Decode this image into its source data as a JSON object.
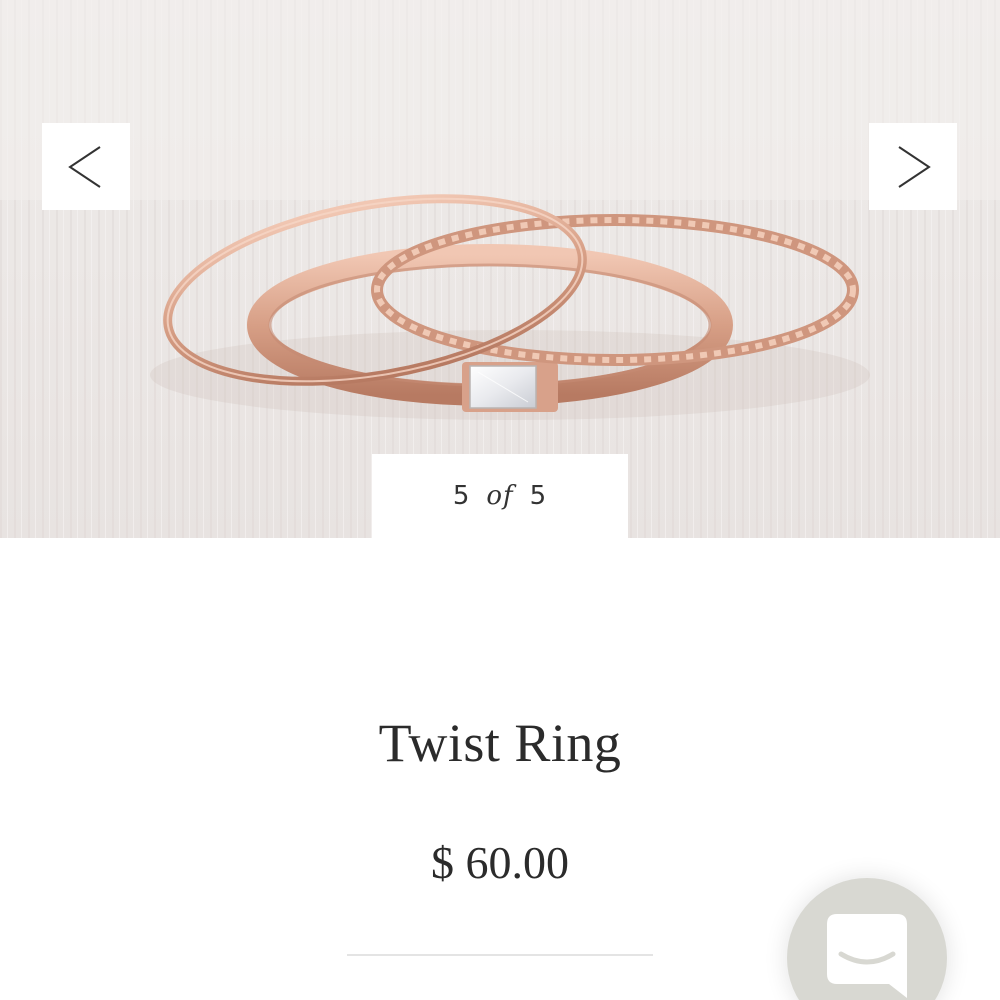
{
  "gallery": {
    "image_alt": "Stack of rose gold rings: plain band, twisted band and baguette diamond band",
    "prev_label": "<",
    "next_label": ">",
    "current": "5",
    "of_word": "of",
    "total": "5"
  },
  "product": {
    "title": "Twist Ring",
    "price": "$ 60.00"
  },
  "chat": {
    "icon": "chat-bubble-icon"
  },
  "colors": {
    "text": "#2b2b2b",
    "ring_gold": "#d9a58d",
    "background_fabric": "#ece8e6",
    "chat_launcher": "#d8d8d2"
  }
}
